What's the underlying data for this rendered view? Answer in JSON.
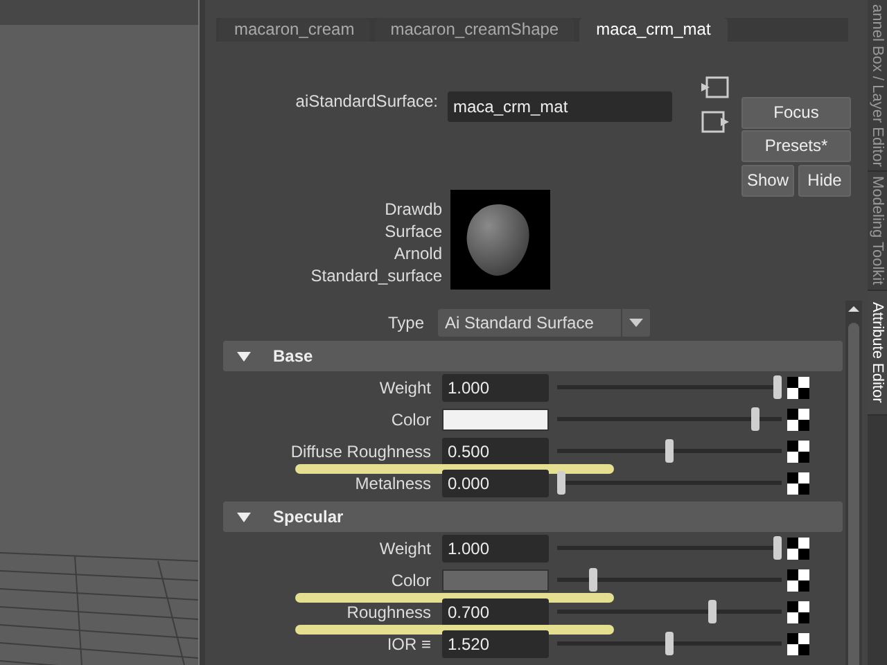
{
  "tabs": [
    {
      "label": "macaron_cream",
      "selected": false
    },
    {
      "label": "macaron_creamShape",
      "selected": false
    },
    {
      "label": "maca_crm_mat",
      "selected": true
    }
  ],
  "node": {
    "type_label": "aiStandardSurface:",
    "name": "maca_crm_mat"
  },
  "buttons": [
    "Focus",
    "Presets*",
    "Show",
    "Hide"
  ],
  "preview": {
    "labels": [
      "Drawdb",
      "Surface",
      "Arnold",
      "Standard_surface"
    ]
  },
  "type": {
    "label": "Type",
    "value": "Ai Standard Surface"
  },
  "sections": [
    {
      "title": "Base",
      "expanded": true,
      "rows": [
        {
          "label": "Weight",
          "kind": "number",
          "value": "1.000",
          "level": 1.0,
          "highlighted": false
        },
        {
          "label": "Color",
          "kind": "color",
          "color": "#f2f2f2",
          "level": 0.9,
          "highlighted": false
        },
        {
          "label": "Diffuse Roughness",
          "kind": "number",
          "value": "0.500",
          "level": 0.5,
          "highlighted": true
        },
        {
          "label": "Metalness",
          "kind": "number",
          "value": "0.000",
          "level": 0.0,
          "highlighted": false
        }
      ]
    },
    {
      "title": "Specular",
      "expanded": true,
      "rows": [
        {
          "label": "Weight",
          "kind": "number",
          "value": "1.000",
          "level": 1.0,
          "highlighted": false
        },
        {
          "label": "Color",
          "kind": "color",
          "color": "#666666",
          "level": 0.15,
          "highlighted": true
        },
        {
          "label": "Roughness",
          "kind": "number",
          "value": "0.700",
          "level": 0.7,
          "highlighted": true
        },
        {
          "label": "IOR ≡",
          "kind": "number",
          "value": "1.520",
          "level": 0.5,
          "highlighted": false
        }
      ]
    }
  ],
  "side_tabs": [
    {
      "label": "annel Box / Layer Editor",
      "selected": false
    },
    {
      "label": "Modeling Toolkit",
      "selected": false
    },
    {
      "label": "Attribute Editor",
      "selected": true
    }
  ]
}
